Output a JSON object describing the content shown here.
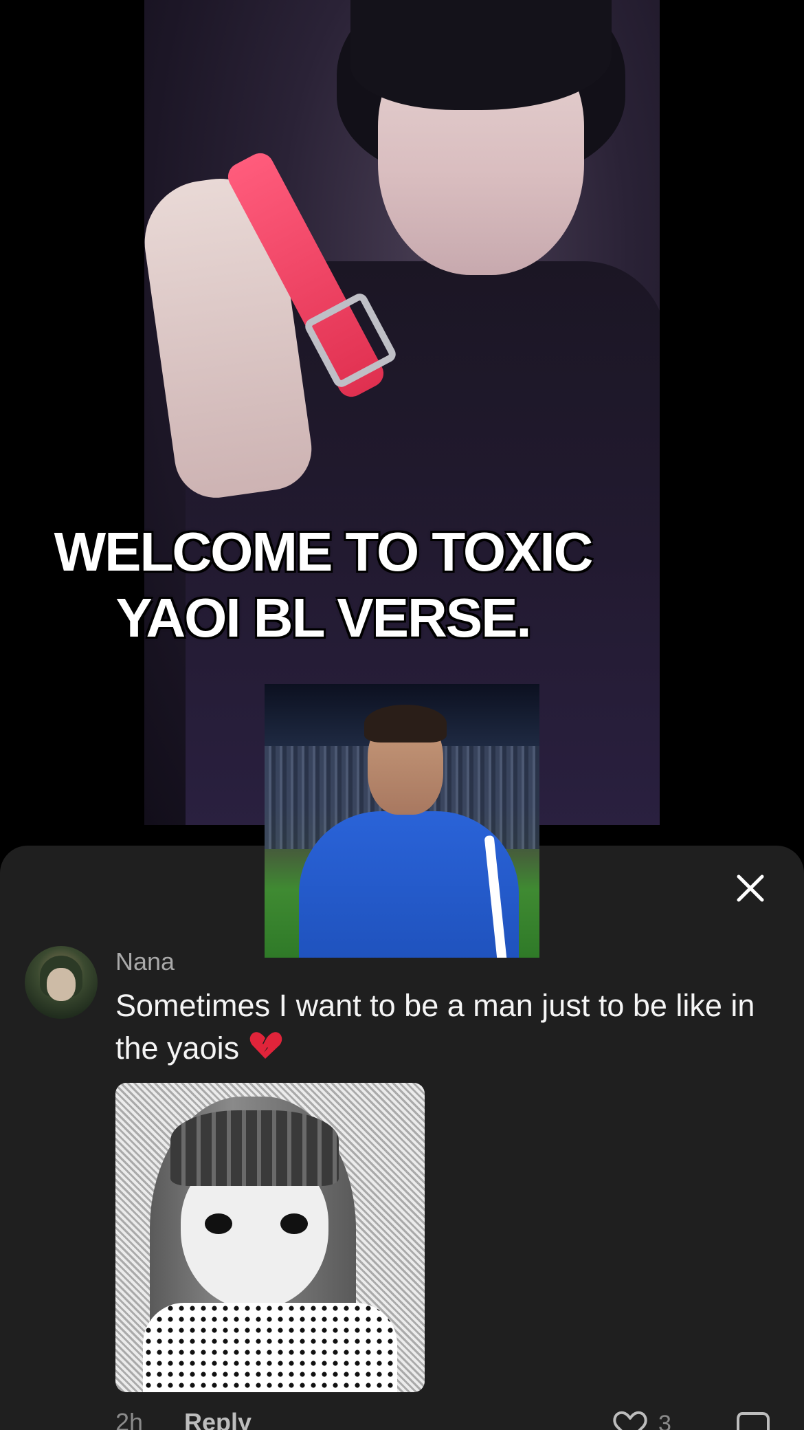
{
  "video": {
    "caption_line1": "WELCOME TO TOXIC",
    "caption_line2": "YAOI BL VERSE."
  },
  "comments_sheet": {
    "close_icon": "close-icon",
    "comment": {
      "username": "Nana",
      "text": "Sometimes I want to be a man just to be like in the yaois",
      "emoji": "broken-heart",
      "time": "2h",
      "reply_label": "Reply",
      "like_count": "3",
      "like_icon": "heart-outline-icon",
      "dislike_icon": "dislike-icon"
    }
  },
  "colors": {
    "sheet_background": "#1f1f1f",
    "username": "#a9a9a9",
    "comment_text": "#f5f5f5",
    "broken_heart": "#e0243a"
  }
}
